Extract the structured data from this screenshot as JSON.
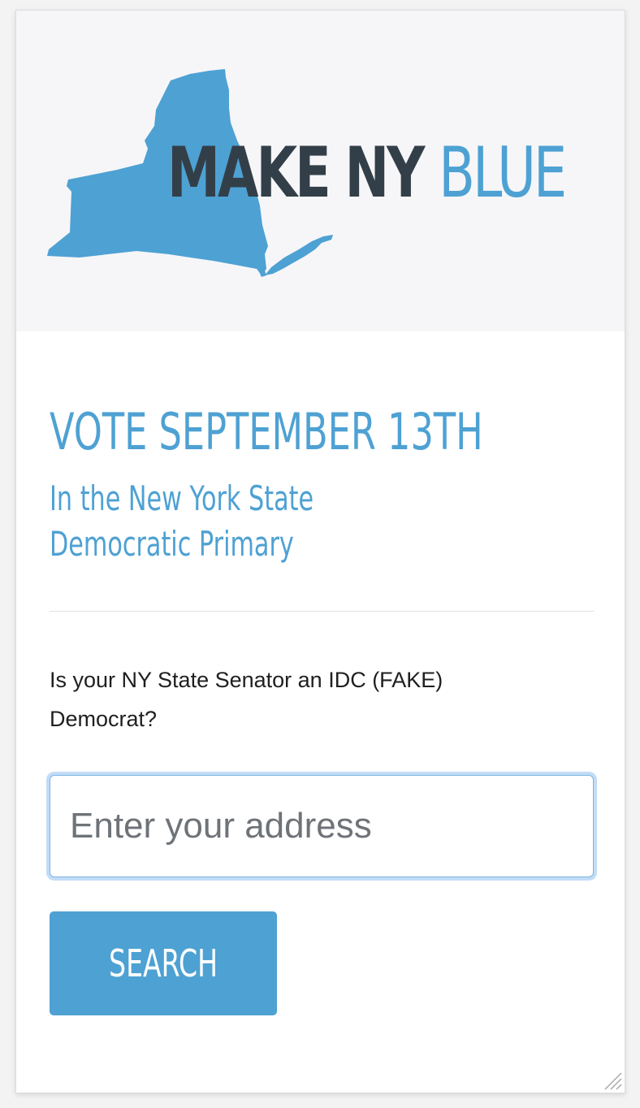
{
  "logo": {
    "word_dark": "MAKE NY",
    "word_blue": "BLUE",
    "map_icon": "new-york-state-map-icon"
  },
  "main": {
    "headline": "VOTE SEPTEMBER 13TH",
    "subhead_line1": "In the New York State",
    "subhead_line2": "Democratic Primary",
    "question": "Is your NY State Senator an IDC (FAKE) Democrat?"
  },
  "search": {
    "placeholder": "Enter your address",
    "value": "",
    "button_label": "SEARCH"
  },
  "colors": {
    "brand_blue": "#4ea1d3",
    "dark_slate": "#333f48",
    "header_bg": "#f6f6f8"
  }
}
